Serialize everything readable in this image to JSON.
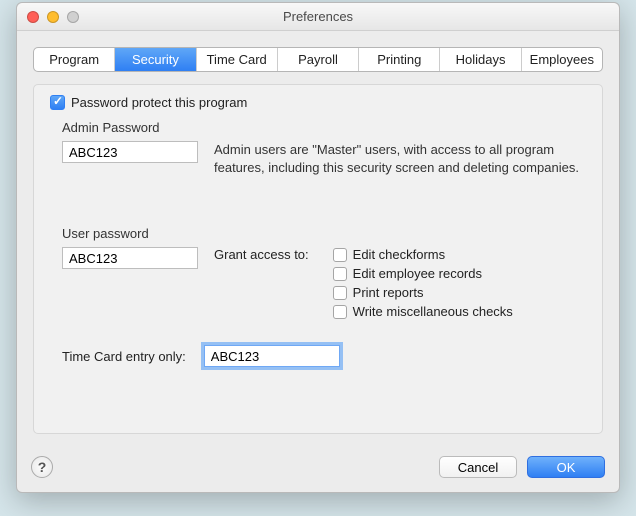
{
  "window": {
    "title": "Preferences"
  },
  "tabs": {
    "items": [
      "Program",
      "Security",
      "Time Card",
      "Payroll",
      "Printing",
      "Holidays",
      "Employees"
    ],
    "activeIndex": 1
  },
  "security": {
    "password_protect_label": "Password protect this program",
    "password_protect_checked": true,
    "admin": {
      "label": "Admin Password",
      "value": "ABC123",
      "description": "Admin users are \"Master\" users, with access to all program features, including this security screen and deleting companies."
    },
    "user": {
      "label": "User password",
      "value": "ABC123",
      "grant_label": "Grant access to:",
      "permissions": [
        {
          "label": "Edit checkforms",
          "checked": false
        },
        {
          "label": "Edit employee records",
          "checked": false
        },
        {
          "label": "Print reports",
          "checked": false
        },
        {
          "label": "Write miscellaneous checks",
          "checked": false
        }
      ]
    },
    "timecard": {
      "label": "Time Card entry only:",
      "value": "ABC123"
    }
  },
  "footer": {
    "cancel": "Cancel",
    "ok": "OK"
  }
}
